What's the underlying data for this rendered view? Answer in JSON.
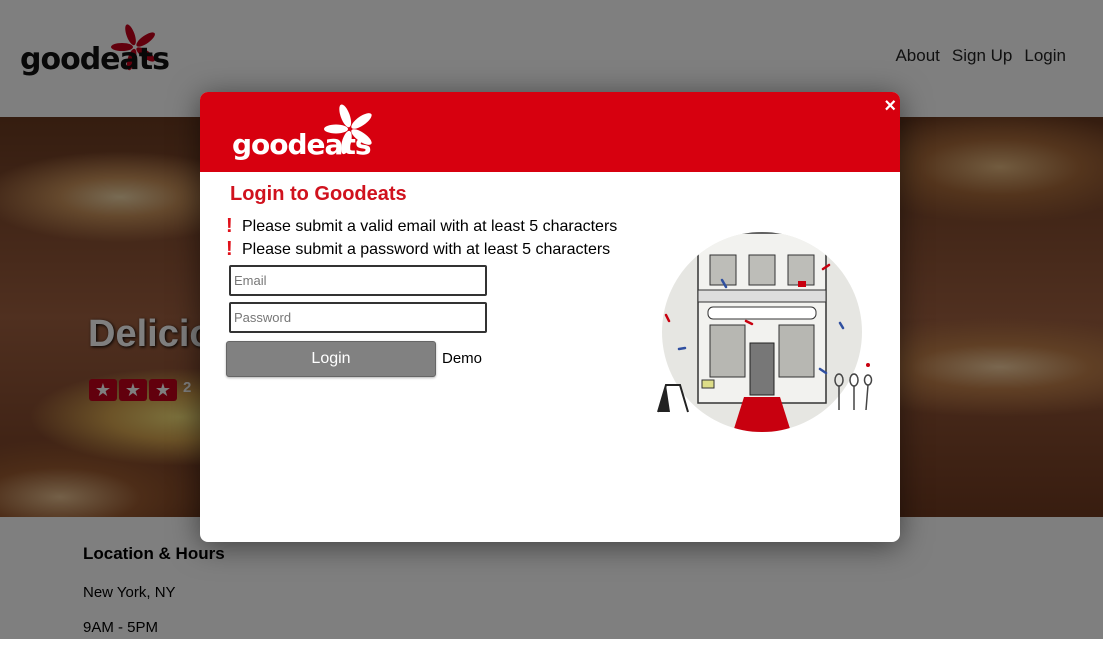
{
  "header": {
    "logo": "goodeats",
    "nav": [
      "About",
      "Sign Up",
      "Login"
    ]
  },
  "hero": {
    "title": "Delicious",
    "stars": 3,
    "rating_count": "2"
  },
  "info": {
    "heading": "Location & Hours",
    "location": "New York, NY",
    "hours": "9AM - 5PM"
  },
  "modal": {
    "logo": "goodeats",
    "close": "×",
    "title": "Login to Goodeats",
    "errors": [
      "Please submit a valid email with at least 5 characters",
      "Please submit a password with at least 5 characters"
    ],
    "email_placeholder": "Email",
    "password_placeholder": "Password",
    "login_label": "Login",
    "demo_label": "Demo"
  },
  "colors": {
    "brand_red": "#d7000f",
    "title_red": "#d0121e",
    "button_gray": "#818181"
  }
}
